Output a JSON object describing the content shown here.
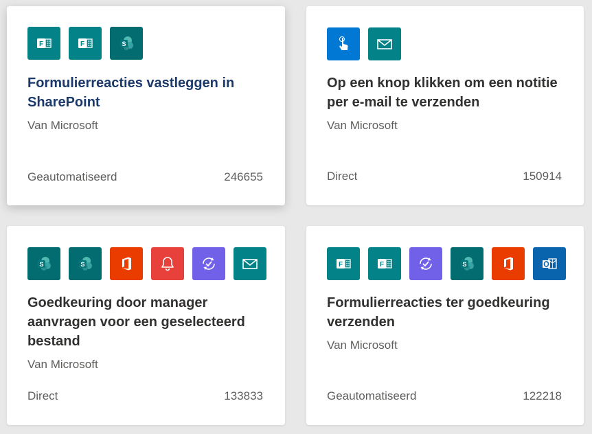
{
  "cards": [
    {
      "title": "Formulierreacties vastleggen in SharePoint",
      "publisher": "Van Microsoft",
      "type": "Geautomatiseerd",
      "count": "246655",
      "hovered": true,
      "icons": [
        {
          "name": "forms-icon",
          "color": "#038387"
        },
        {
          "name": "forms-icon",
          "color": "#038387"
        },
        {
          "name": "sharepoint-icon",
          "color": "#036c70"
        }
      ]
    },
    {
      "title": "Op een knop klikken om een notitie per e-mail te verzenden",
      "publisher": "Van Microsoft",
      "type": "Direct",
      "count": "150914",
      "hovered": false,
      "icons": [
        {
          "name": "button-touch-icon",
          "color": "#0078d4"
        },
        {
          "name": "mail-icon",
          "color": "#038387"
        }
      ]
    },
    {
      "title": "Goedkeuring door manager aanvragen voor een geselecteerd bestand",
      "publisher": "Van Microsoft",
      "type": "Direct",
      "count": "133833",
      "hovered": false,
      "icons": [
        {
          "name": "sharepoint-icon",
          "color": "#036c70"
        },
        {
          "name": "sharepoint-icon",
          "color": "#036c70"
        },
        {
          "name": "office-icon",
          "color": "#eb3c00"
        },
        {
          "name": "notification-bell-icon",
          "color": "#e8403a"
        },
        {
          "name": "approvals-icon",
          "color": "#7160e8"
        },
        {
          "name": "mail-icon",
          "color": "#038387"
        }
      ]
    },
    {
      "title": "Formulierreacties ter goedkeuring verzenden",
      "publisher": "Van Microsoft",
      "type": "Geautomatiseerd",
      "count": "122218",
      "hovered": false,
      "icons": [
        {
          "name": "forms-icon",
          "color": "#038387"
        },
        {
          "name": "forms-icon",
          "color": "#038387"
        },
        {
          "name": "approvals-icon",
          "color": "#7160e8"
        },
        {
          "name": "sharepoint-icon",
          "color": "#036c70"
        },
        {
          "name": "office-icon",
          "color": "#eb3c00"
        },
        {
          "name": "outlook-icon",
          "color": "#0a64ad"
        }
      ]
    }
  ]
}
